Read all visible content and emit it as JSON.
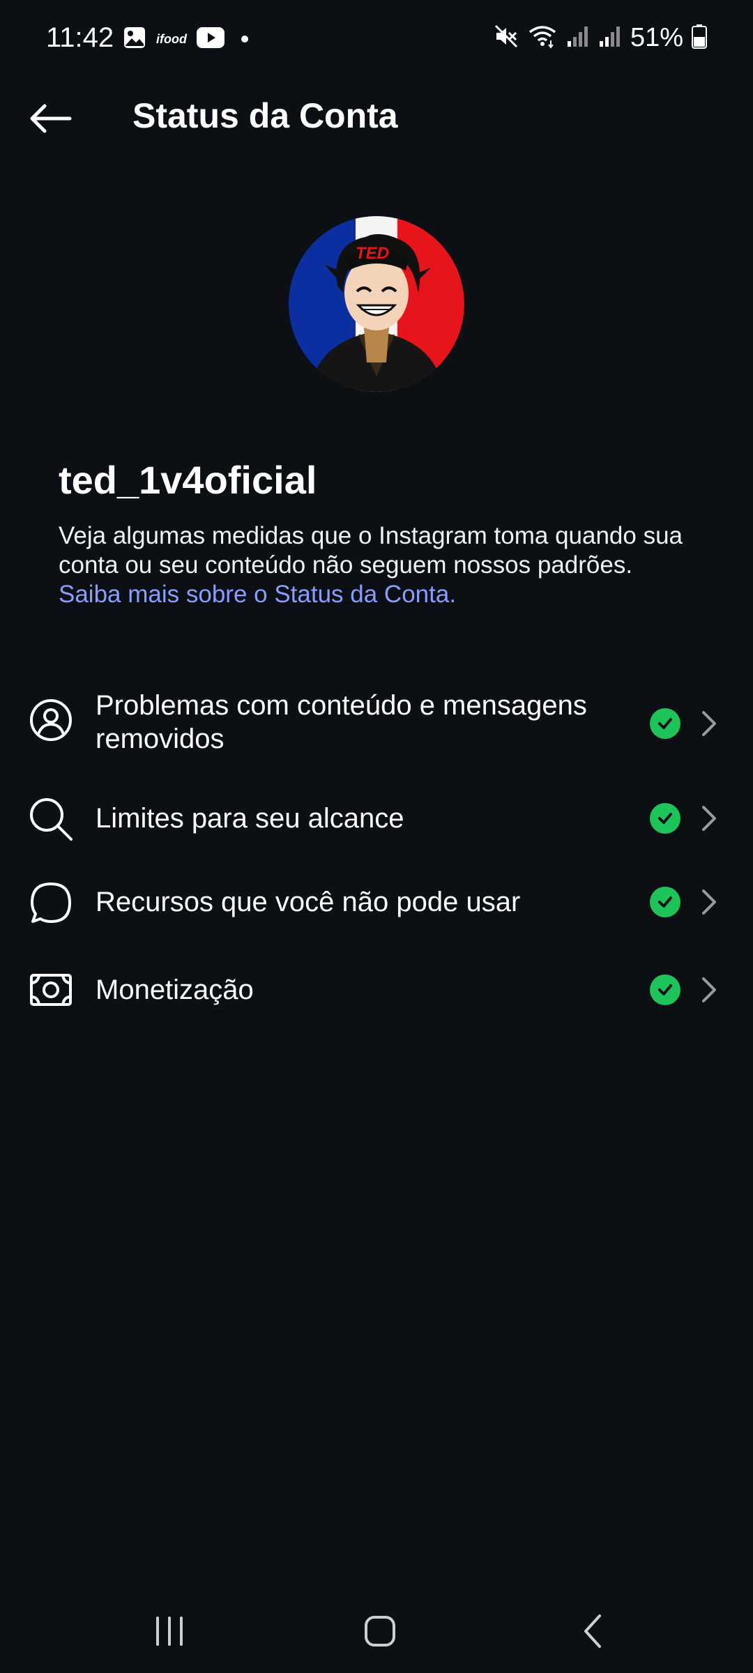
{
  "status_bar": {
    "time": "11:42",
    "notification_app_label": "ifood",
    "battery_percent": "51%",
    "icons": [
      "gallery-icon",
      "ifood-icon",
      "youtube-icon",
      "notification-dot",
      "mute-icon",
      "wifi-icon",
      "signal-icon",
      "battery-icon"
    ]
  },
  "header": {
    "title": "Status da Conta",
    "back_icon": "arrow-left-icon"
  },
  "profile": {
    "username": "ted_1v4oficial",
    "cap_text": "TED",
    "description": "Veja algumas medidas que o Instagram toma quando sua conta ou seu conteúdo não seguem nossos padrões.",
    "link_text": "Saiba mais sobre o Status da Conta."
  },
  "status_items": [
    {
      "label": "Problemas com conteúdo e mensagens removidos",
      "icon": "user-circle-icon",
      "status": "ok"
    },
    {
      "label": "Limites para seu alcance",
      "icon": "search-icon",
      "status": "ok"
    },
    {
      "label": "Recursos que você não pode usar",
      "icon": "speech-bubble-icon",
      "status": "ok"
    },
    {
      "label": "Monetização",
      "icon": "money-icon",
      "status": "ok"
    }
  ],
  "nav_bar": {
    "buttons": [
      "recents-button",
      "home-button",
      "back-button"
    ]
  },
  "colors": {
    "background": "#0c0f14",
    "link": "#8a9cff",
    "status_ok": "#1dc45a"
  }
}
